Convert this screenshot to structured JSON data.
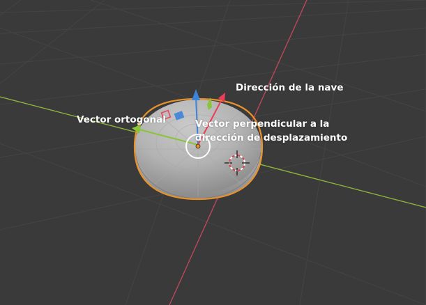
{
  "annotations": {
    "ship_direction": "Dirección de la nave",
    "orthogonal_vector": "Vector ortogonal",
    "perpendicular_line1": "Vector perpendicular a la",
    "perpendicular_line2": "dirección de desplazamiento"
  },
  "colors": {
    "background": "#3a3a3a",
    "grid_line": "#444444",
    "x_axis": "#8bb63b",
    "y_axis": "#b7495a",
    "selection_outline": "#e8922c",
    "gizmo_x": "#ec3e58",
    "gizmo_y": "#8ac438",
    "gizmo_z": "#3d83d8",
    "text": "#ffffff"
  },
  "icons": [
    "transform-gizmo-icon",
    "object-origin-icon",
    "3d-cursor-icon"
  ]
}
